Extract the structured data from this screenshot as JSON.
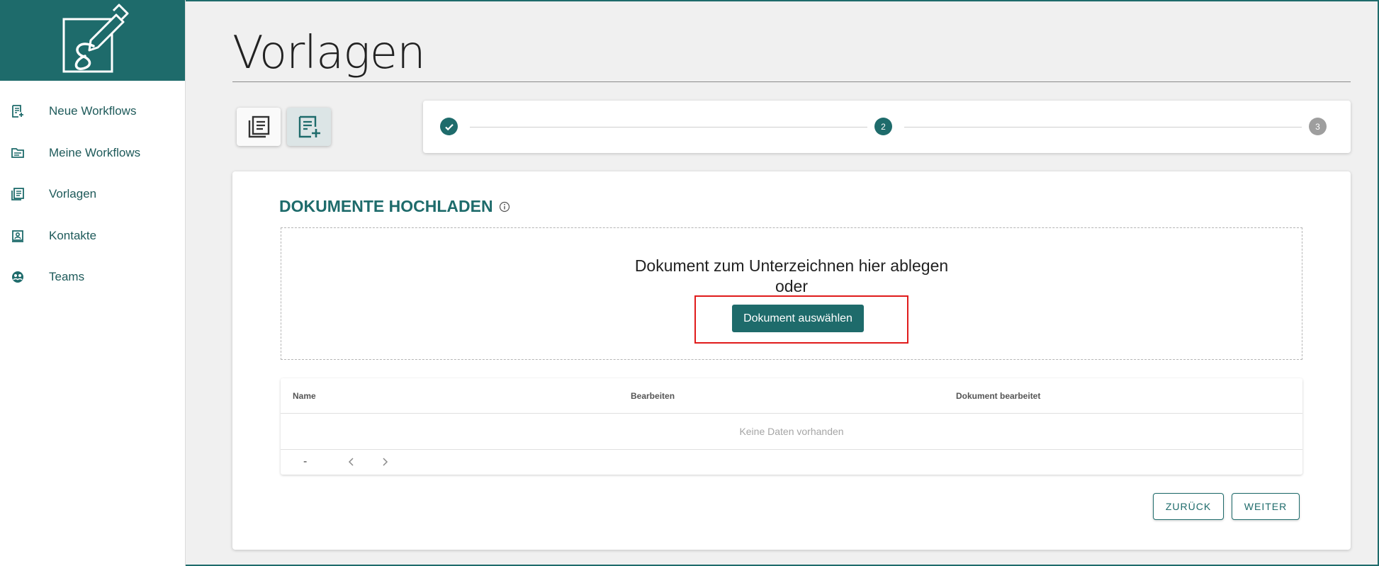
{
  "colors": {
    "brand": "#1e6b6b",
    "highlight": "#e01b1b",
    "step_pending": "#9e9e9e"
  },
  "sidebar": {
    "logo_icon": "signature-pen-icon",
    "items": [
      {
        "label": "Neue Workflows",
        "icon": "new-workflow-icon"
      },
      {
        "label": "Meine Workflows",
        "icon": "folder-icon"
      },
      {
        "label": "Vorlagen",
        "icon": "templates-icon"
      },
      {
        "label": "Kontakte",
        "icon": "contacts-icon"
      },
      {
        "label": "Teams",
        "icon": "teams-icon"
      }
    ]
  },
  "page": {
    "title": "Vorlagen"
  },
  "stepper": {
    "current_step": 2,
    "steps": [
      {
        "label": "",
        "state": "done"
      },
      {
        "label": "2",
        "state": "active"
      },
      {
        "label": "3",
        "state": "pending"
      }
    ]
  },
  "upload": {
    "section_title": "DOKUMENTE HOCHLADEN",
    "drop_text": "Dokument zum Unterzeichnen hier ablegen",
    "or_text": "oder",
    "select_button": "Dokument auswählen"
  },
  "table": {
    "columns": [
      "Name",
      "Bearbeiten",
      "Dokument bearbeitet"
    ],
    "empty_message": "Keine Daten vorhanden",
    "pagination": {
      "range": "-"
    }
  },
  "footer": {
    "back_label": "ZURÜCK",
    "next_label": "WEITER"
  }
}
